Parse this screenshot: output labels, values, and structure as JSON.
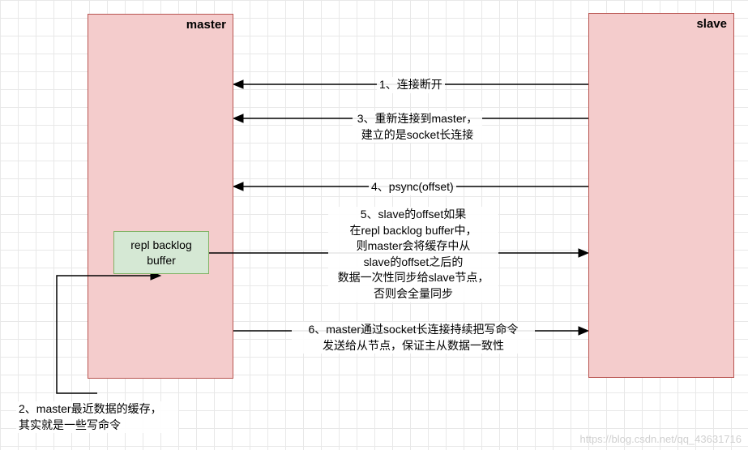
{
  "master": {
    "label": "master",
    "inner_box": "repl backlog\nbuffer"
  },
  "slave": {
    "label": "slave"
  },
  "arrows": {
    "a1": "1、连接断开",
    "a3": "3、重新连接到master，\n建立的是socket长连接",
    "a4": "4、psync(offset)",
    "a5": "5、slave的offset如果\n在repl backlog buffer中，\n则master会将缓存中从\nslave的offset之后的\n数据一次性同步给slave节点，\n否则会全量同步",
    "a6": "6、master通过socket长连接持续把写命令\n发送给从节点，保证主从数据一致性"
  },
  "note2": "2、master最近数据的缓存，\n其实就是一些写命令",
  "watermark": "https://blog.csdn.net/qq_43631716"
}
